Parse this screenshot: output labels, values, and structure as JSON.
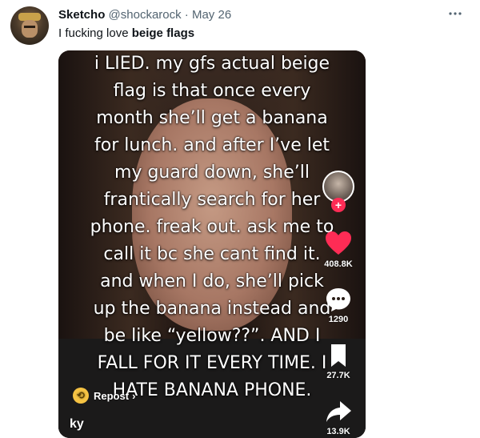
{
  "tweet": {
    "display_name": "Sketcho",
    "handle": "@shockarock",
    "separator": "·",
    "date": "May 26",
    "more_icon": "more-horizontal-icon",
    "text_prefix": "I fucking love ",
    "text_bold": "beige flags"
  },
  "video": {
    "caption": "i LIED. my gfs actual beige\nflag is that once every\nmonth she’ll get a banana\nfor lunch. and after I’ve let\nmy guard down, she’ll\nfrantically search for her\nphone. freak out. ask me to\ncall it bc she cant find it.\nand when I do, she’ll pick\nup the banana instead and\nbe like “yellow??”. AND I\nFALL FOR IT EVERY TIME. I\nHATE BANANA PHONE.",
    "likes_count": "408.8K",
    "comments_count": "1290",
    "saves_count": "27.7K",
    "shares_count": "13.9K",
    "repost_label": "Repost",
    "repost_chevron": "›",
    "username_partial": "ky",
    "plus_symbol": "+",
    "colors": {
      "like": "#fe2c55",
      "repost_badge": "#f6c343"
    },
    "icons": [
      "heart-icon",
      "comment-icon",
      "bookmark-icon",
      "share-arrow-icon",
      "repost-icon",
      "plus-icon"
    ]
  }
}
